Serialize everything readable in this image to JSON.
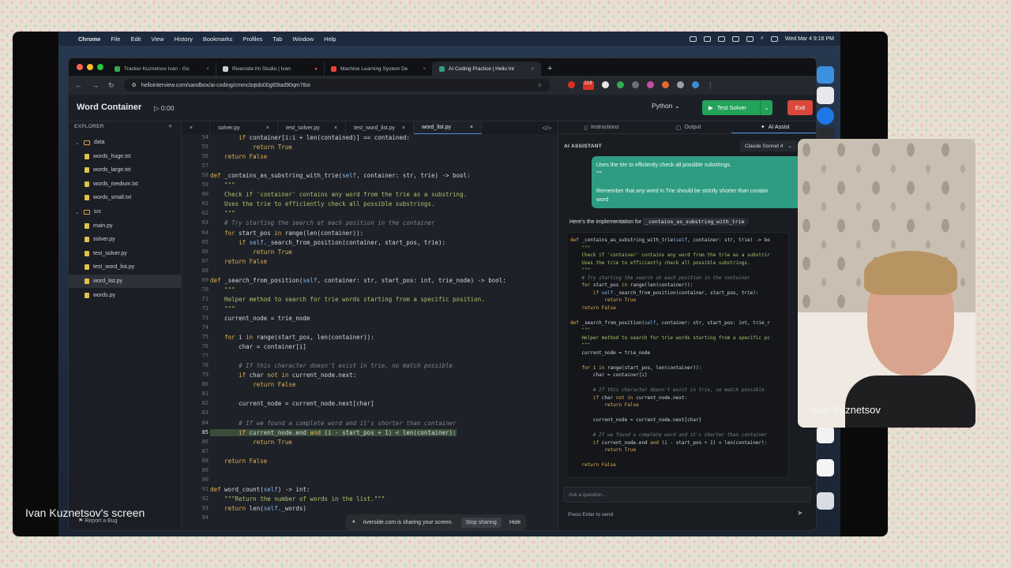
{
  "mac_menu": {
    "app": "Chrome",
    "items": [
      "File",
      "Edit",
      "View",
      "History",
      "Bookmarks",
      "Profiles",
      "Tab",
      "Window",
      "Help"
    ],
    "clock": "Wed Mar 4  9:16 PM"
  },
  "browser": {
    "tabs": [
      {
        "label": "Tracker Kuznetsov Ivan - Go",
        "color": "#34a853",
        "active": false
      },
      {
        "label": "Riverside.fm Studio | Ivan",
        "color": "#c9ced5",
        "active": false
      },
      {
        "label": "Machine Learning System De",
        "color": "#ea4335",
        "active": false
      },
      {
        "label": "AI Coding Practice | Hello Int",
        "color": "#2e9c82",
        "active": true
      }
    ],
    "url": "hellointerview.com/sandbox/ai-coding/cmmcbqtdo00gt09ad90qm76oi",
    "badge": "219"
  },
  "app": {
    "title": "Word Container",
    "timer": "0:00",
    "language": "Python",
    "test_button": "Test Solver",
    "exit_button": "Exit"
  },
  "explorer": {
    "title": "EXPLORER",
    "items": [
      {
        "label": "data",
        "type": "folder",
        "depth": 0
      },
      {
        "label": "words_huge.txt",
        "type": "file",
        "depth": 1
      },
      {
        "label": "words_large.txt",
        "type": "file",
        "depth": 1
      },
      {
        "label": "words_medium.txt",
        "type": "file",
        "depth": 1
      },
      {
        "label": "words_small.txt",
        "type": "file",
        "depth": 1
      },
      {
        "label": "src",
        "type": "folder",
        "depth": 0
      },
      {
        "label": "main.py",
        "type": "file",
        "depth": 1
      },
      {
        "label": "solver.py",
        "type": "file",
        "depth": 1
      },
      {
        "label": "test_solver.py",
        "type": "file",
        "depth": 1
      },
      {
        "label": "test_word_list.py",
        "type": "file",
        "depth": 1
      },
      {
        "label": "word_list.py",
        "type": "file",
        "depth": 1,
        "selected": true
      },
      {
        "label": "words.py",
        "type": "file",
        "depth": 1
      }
    ],
    "report": "Report a Bug"
  },
  "editor": {
    "tabs": [
      "solver.py",
      "test_solver.py",
      "test_word_list.py",
      "word_list.py"
    ],
    "active_tab": "word_list.py",
    "current_line": 85,
    "line_numbers": [
      54,
      55,
      56,
      57,
      58,
      59,
      60,
      61,
      62,
      63,
      64,
      65,
      66,
      67,
      68,
      69,
      70,
      71,
      72,
      73,
      74,
      75,
      76,
      77,
      78,
      79,
      80,
      81,
      82,
      83,
      84,
      85,
      86,
      87,
      88,
      89,
      90,
      91,
      92,
      93,
      94
    ],
    "lines": [
      "        if container[i:i + len(contained)] == contained:",
      "            return True",
      "    return False",
      "",
      "def _contains_as_substring_with_trie(self, container: str, trie) -> bool:",
      "    \"\"\"",
      "    Check if 'container' contains any word from the trie as a substring.",
      "    Uses the trie to efficiently check all possible substrings.",
      "    \"\"\"",
      "    # Try starting the search at each position in the container",
      "    for start_pos in range(len(container)):",
      "        if self._search_from_position(container, start_pos, trie):",
      "            return True",
      "    return False",
      "",
      "def _search_from_position(self, container: str, start_pos: int, trie_node) -> bool:",
      "    \"\"\"",
      "    Helper method to search for trie words starting from a specific position.",
      "    \"\"\"",
      "    current_node = trie_node",
      "",
      "    for i in range(start_pos, len(container)):",
      "        char = container[i]",
      "",
      "        # If this character doesn't exist in trie, no match possible",
      "        if char not in current_node.next:",
      "            return False",
      "",
      "        current_node = current_node.next[char]",
      "",
      "        # If we found a complete word and it's shorter than container",
      "        if current_node.end and (i - start_pos + 1) < len(container):",
      "            return True",
      "",
      "    return False",
      "",
      "",
      "def word_count(self) -> int:",
      "    \"\"\"Return the number of words in the list.\"\"\"",
      "    return len(self._words)",
      ""
    ]
  },
  "right_panel": {
    "tabs": [
      "Instructions",
      "Output",
      "AI Assist"
    ],
    "active_tab": "AI Assist",
    "ai_label": "AI ASSISTANT",
    "model": "Claude Sonnet 4",
    "user_message": [
      "Uses the trie to efficiently check all possible substrings.",
      "\"\"\"",
      "",
      "Remember that any word in Trie should be strictly shorter than contain",
      "word"
    ],
    "bot_intro": "Here's the implementation for",
    "bot_intro_code": "_contains_as_substring_with_trie",
    "bot_intro_end": ":",
    "bot_code": [
      "def _contains_as_substring_with_trie(self, container: str, trie) -> bo",
      "    \"\"\"",
      "    Check if 'container' contains any word from the trie as a substrir",
      "    Uses the trie to efficiently check all possible substrings.",
      "    \"\"\"",
      "    # Try starting the search at each position in the container",
      "    for start_pos in range(len(container)):",
      "        if self._search_from_position(container, start_pos, trie):",
      "            return True",
      "    return False",
      "",
      "def _search_from_position(self, container: str, start_pos: int, trie_r",
      "    \"\"\"",
      "    Helper method to search for trie words starting from a specific pc",
      "    \"\"\"",
      "    current_node = trie_node",
      "",
      "    for i in range(start_pos, len(container)):",
      "        char = container[i]",
      "",
      "        # If this character doesn't exist in trie, no match possible",
      "        if char not in current_node.next:",
      "            return False",
      "",
      "        current_node = current_node.next[char]",
      "",
      "        # If we found a complete word and it's shorter than container",
      "        if current_node.end and (i - start_pos + 1) < len(container):",
      "            return True",
      "",
      "    return False"
    ],
    "ask_placeholder": "Ask a question...",
    "send_hint": "Press Enter to send"
  },
  "share_bar": {
    "text": "riverside.com is sharing your screen.",
    "stop": "Stop sharing",
    "hide": "Hide"
  },
  "overlay": {
    "screen_label": "Ivan Kuznetsov's screen",
    "camera_name": "Ivan Kuznetsov"
  }
}
